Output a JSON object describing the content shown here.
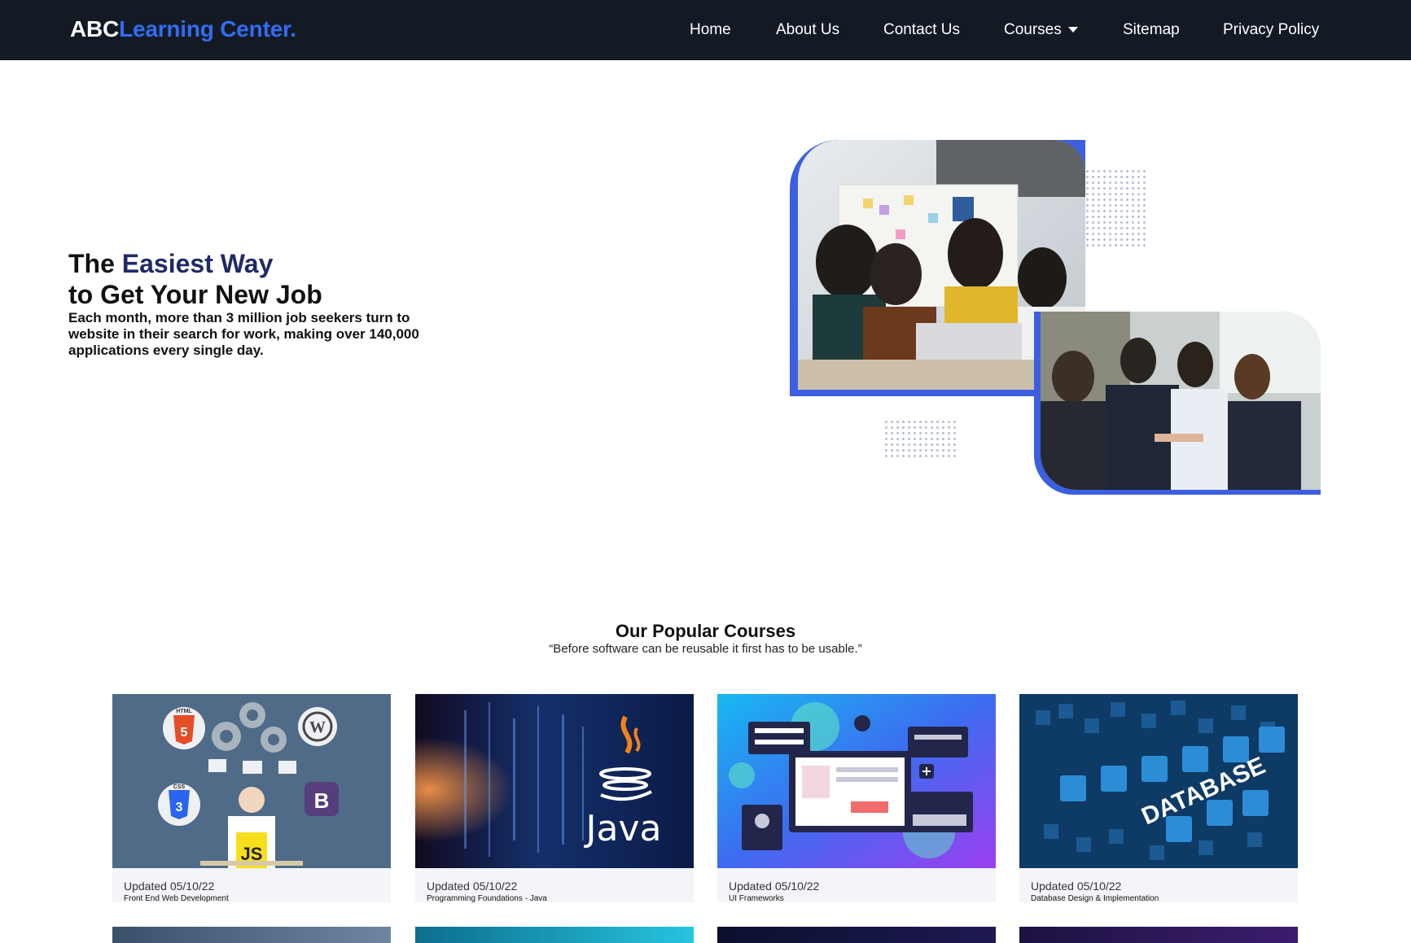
{
  "brand": {
    "part1": "ABC",
    "part2": "Learning Center."
  },
  "nav": {
    "home": "Home",
    "about": "About Us",
    "contact": "Contact Us",
    "courses": "Courses",
    "sitemap": "Sitemap",
    "privacy": "Privacy Policy"
  },
  "hero": {
    "title_prefix": "The ",
    "title_accent": "Easiest Way",
    "title_line2": "to Get Your New Job",
    "description": "Each month, more than 3 million job seekers turn to website in their search for work, making over 140,000 applications every single day."
  },
  "courses_section": {
    "title": "Our Popular Courses",
    "subtitle": "“Before software can be reusable it first has to be usable.”",
    "cards": [
      {
        "updated": "Updated 05/10/22",
        "title": "Front End Web Development",
        "thumb_text_1": "HTML",
        "thumb_text_2": "CSS",
        "thumb_text_3": "JS",
        "thumb_text_4": "B"
      },
      {
        "updated": "Updated 05/10/22",
        "title": "Programming Foundations - Java",
        "thumb_text": "Java"
      },
      {
        "updated": "Updated 05/10/22",
        "title": "UI Frameworks"
      },
      {
        "updated": "Updated 05/10/22",
        "title": "Database Design & Implementation",
        "thumb_text": "DATABASE"
      }
    ]
  },
  "colors": {
    "nav_bg": "#141a24",
    "accent_blue": "#2f6df2",
    "frame_blue": "#3b5fe0",
    "title_navy": "#1f2a66"
  },
  "icons": [
    "caret-down-icon",
    "html5-icon",
    "css3-icon",
    "js-icon",
    "bootstrap-icon",
    "wordpress-icon",
    "java-icon"
  ]
}
